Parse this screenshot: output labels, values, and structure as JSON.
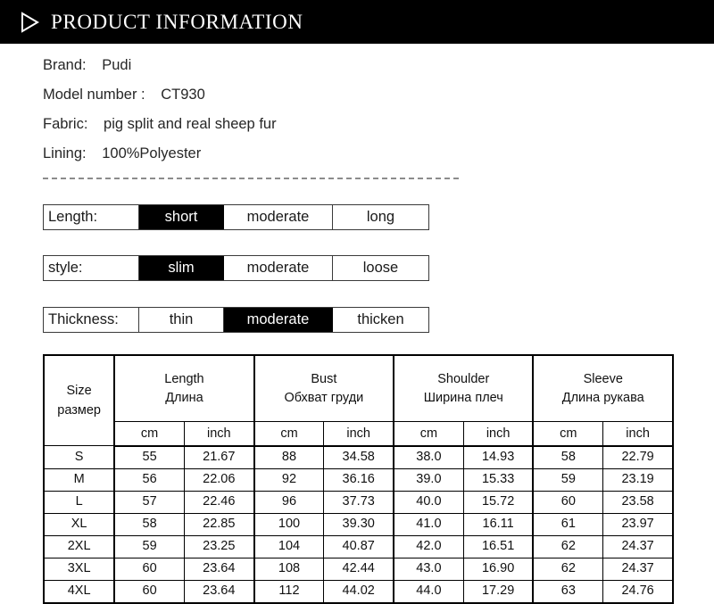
{
  "header": {
    "title": "PRODUCT INFORMATION",
    "icon": "play-triangle-icon",
    "background": "#000000",
    "text_color": "#ffffff"
  },
  "specs": [
    {
      "label": "Brand:",
      "value": "Pudi"
    },
    {
      "label": "Model number :",
      "value": "CT930"
    },
    {
      "label": "Fabric:",
      "value": "pig split and real sheep fur"
    },
    {
      "label": "Lining:",
      "value": "100%Polyester"
    }
  ],
  "selectors": [
    {
      "label": "Length:",
      "options": [
        "short",
        "moderate",
        "long"
      ],
      "selected": "short"
    },
    {
      "label": "style:",
      "options": [
        "slim",
        "moderate",
        "loose"
      ],
      "selected": "slim"
    },
    {
      "label": "Thickness:",
      "options": [
        "thin",
        "moderate",
        "thicken"
      ],
      "selected": "moderate"
    }
  ],
  "size_table": {
    "size_header": {
      "en": "Size",
      "ru": "размер"
    },
    "groups": [
      {
        "en": "Length",
        "ru": "Длина"
      },
      {
        "en": "Bust",
        "ru": "Обхват груди"
      },
      {
        "en": "Shoulder",
        "ru": "Ширина плеч"
      },
      {
        "en": "Sleeve",
        "ru": "Длина рукава"
      }
    ],
    "units": [
      "cm",
      "inch",
      "cm",
      "inch",
      "cm",
      "inch",
      "cm",
      "inch"
    ],
    "rows": [
      {
        "size": "S",
        "values": [
          "55",
          "21.67",
          "88",
          "34.58",
          "38.0",
          "14.93",
          "58",
          "22.79"
        ]
      },
      {
        "size": "M",
        "values": [
          "56",
          "22.06",
          "92",
          "36.16",
          "39.0",
          "15.33",
          "59",
          "23.19"
        ]
      },
      {
        "size": "L",
        "values": [
          "57",
          "22.46",
          "96",
          "37.73",
          "40.0",
          "15.72",
          "60",
          "23.58"
        ]
      },
      {
        "size": "XL",
        "values": [
          "58",
          "22.85",
          "100",
          "39.30",
          "41.0",
          "16.11",
          "61",
          "23.97"
        ]
      },
      {
        "size": "2XL",
        "values": [
          "59",
          "23.25",
          "104",
          "40.87",
          "42.0",
          "16.51",
          "62",
          "24.37"
        ]
      },
      {
        "size": "3XL",
        "values": [
          "60",
          "23.64",
          "108",
          "42.44",
          "43.0",
          "16.90",
          "62",
          "24.37"
        ]
      },
      {
        "size": "4XL",
        "values": [
          "60",
          "23.64",
          "112",
          "44.02",
          "44.0",
          "17.29",
          "63",
          "24.76"
        ]
      }
    ]
  },
  "colors": {
    "page_background": "#ffffff",
    "header_background": "#000000",
    "selected_cell_background": "#000000",
    "selected_cell_text": "#ffffff",
    "divider": "#8c8c8c",
    "table_border": "#000000"
  }
}
